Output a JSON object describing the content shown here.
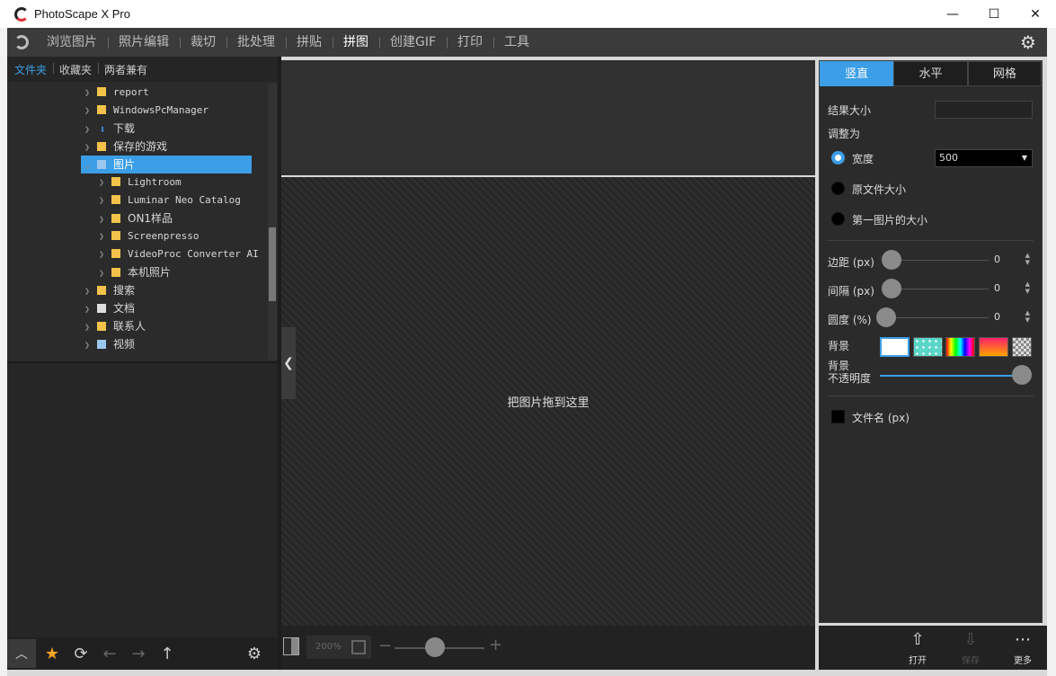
{
  "window": {
    "title": "PhotoScape X Pro",
    "controls": {
      "minimize": "—",
      "maximize": "☐",
      "close": "✕"
    }
  },
  "menu": {
    "items": [
      "浏览图片",
      "照片编辑",
      "裁切",
      "批处理",
      "拼贴",
      "拼图",
      "创建GIF",
      "打印",
      "工具"
    ],
    "active": "拼图"
  },
  "left_panel": {
    "tabs": [
      "文件夹",
      "收藏夹",
      "两者兼有"
    ],
    "active_tab": "文件夹",
    "tree": [
      {
        "label": "report",
        "icon": "folder-icon",
        "level": 1
      },
      {
        "label": "WindowsPcManager",
        "icon": "folder-icon",
        "level": 1
      },
      {
        "label": "下载",
        "icon": "download-icon",
        "level": 1
      },
      {
        "label": "保存的游戏",
        "icon": "folder-icon",
        "level": 1
      },
      {
        "label": "图片",
        "icon": "pictures-icon",
        "level": 1,
        "expanded": true,
        "selected": true
      },
      {
        "label": "Lightroom",
        "icon": "folder-icon",
        "level": 2
      },
      {
        "label": "Luminar Neo Catalog",
        "icon": "folder-icon",
        "level": 2
      },
      {
        "label": "ON1样品",
        "icon": "folder-icon",
        "level": 2
      },
      {
        "label": "Screenpresso",
        "icon": "folder-icon",
        "level": 2
      },
      {
        "label": "VideoProc Converter AI",
        "icon": "folder-icon",
        "level": 2
      },
      {
        "label": "本机照片",
        "icon": "folder-icon",
        "level": 2
      },
      {
        "label": "搜索",
        "icon": "search-folder-icon",
        "level": 1
      },
      {
        "label": "文档",
        "icon": "documents-icon",
        "level": 1
      },
      {
        "label": "联系人",
        "icon": "contacts-icon",
        "level": 1
      },
      {
        "label": "视频",
        "icon": "videos-icon",
        "level": 1
      }
    ]
  },
  "center": {
    "drop_text": "把图片拖到这里",
    "zoom": "200%"
  },
  "right_panel": {
    "tabs": [
      "竖直",
      "水平",
      "网格"
    ],
    "active_tab": "竖直",
    "result_size_label": "结果大小",
    "adjust_label": "调整为",
    "options": {
      "width_label": "宽度",
      "original_label": "原文件大小",
      "first_image_label": "第一图片的大小"
    },
    "width_value": "500",
    "margin_label": "边距 (px)",
    "margin_value": "0",
    "spacing_label": "间隔 (px)",
    "spacing_value": "0",
    "radius_label": "圆度 (%)",
    "radius_value": "0",
    "background_label": "背景",
    "opacity_label_1": "背景",
    "opacity_label_2": "不透明度",
    "opacity_value": 1.0,
    "filename_label": "文件名 (px)"
  },
  "actions": {
    "open": "打开",
    "save": "保存",
    "more": "更多"
  },
  "colors": {
    "accent": "#3b9ee6",
    "folder": "#f3c24a",
    "favorite": "#f5a623"
  }
}
